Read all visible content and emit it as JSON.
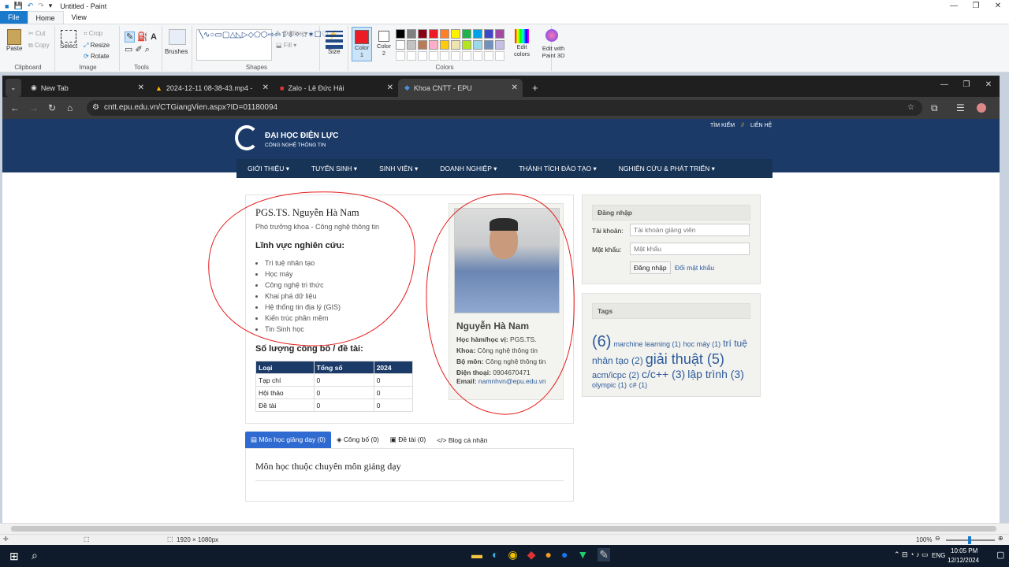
{
  "paint": {
    "title": "Untitled - Paint",
    "tabs": [
      "File",
      "Home",
      "View"
    ],
    "clipboard": {
      "paste": "Paste",
      "cut": "Cut",
      "copy": "Copy",
      "label": "Clipboard"
    },
    "image": {
      "select": "Select",
      "crop": "Crop",
      "resize": "Resize",
      "rotate": "Rotate",
      "label": "Image"
    },
    "tools": {
      "label": "Tools"
    },
    "brushes": {
      "label": "Brushes"
    },
    "shapes": {
      "outline": "Outline",
      "fill": "Fill",
      "label": "Shapes"
    },
    "size": {
      "label": "Size"
    },
    "colors": {
      "color1": "Color 1",
      "color2": "Color 2",
      "edit": "Edit colors",
      "paint3d": "Edit with Paint 3D",
      "label": "Colors",
      "palette": [
        "#000000",
        "#7f7f7f",
        "#880015",
        "#ed1c24",
        "#ff7f27",
        "#fff200",
        "#22b14c",
        "#00a2e8",
        "#3f48cc",
        "#a349a4",
        "#ffffff",
        "#c3c3c3",
        "#b97a57",
        "#ffaec9",
        "#ffc90e",
        "#efe4b0",
        "#b5e61d",
        "#99d9ea",
        "#7092be",
        "#c8bfe7"
      ]
    },
    "status": {
      "size": "1920 × 1080px",
      "zoom": "100%"
    }
  },
  "browser": {
    "tabs": [
      {
        "label": "New Tab"
      },
      {
        "label": "2024-12-11 08-38-43.mp4 - Go"
      },
      {
        "label": "Zalo - Lê Đức Hải"
      },
      {
        "label": "Khoa CNTT - EPU"
      }
    ],
    "url": "cntt.epu.edu.vn/CTGiangVien.aspx?ID=01180094"
  },
  "site": {
    "logo_line1": "ĐẠI HỌC ĐIỆN LỰC",
    "logo_line2": "CÔNG NGHỆ THÔNG TIN",
    "top_links": [
      "TÌM KIẾM",
      "//",
      "LIÊN HỆ"
    ],
    "nav": [
      "GIỚI THIỆU ▾",
      "TUYỂN SINH ▾",
      "SINH VIÊN ▾",
      "DOANH NGHIỆP ▾",
      "THÀNH TÍCH ĐÀO TẠO ▾",
      "NGHIÊN CỨU & PHÁT TRIỂN ▾"
    ]
  },
  "profile": {
    "name_title": "PGS.TS. Nguyễn Hà Nam",
    "position": "Phó trưởng khoa - Công nghệ thông tin",
    "research_heading": "Lĩnh vực nghiên cứu:",
    "research": [
      "Trí tuệ nhân tạo",
      "Học máy",
      "Công nghệ tri thức",
      "Khai phá dữ liệu",
      "Hệ thống tin địa lý (GIS)",
      "Kiến trúc phần mềm",
      "Tin Sinh học"
    ],
    "pub_heading": "Số lượng công bố / đề tài:",
    "table_headers": [
      "Loại",
      "Tổng số",
      "2024"
    ],
    "table_rows": [
      [
        "Tạp chí",
        "0",
        "0"
      ],
      [
        "Hội thảo",
        "0",
        "0"
      ],
      [
        "Đề tài",
        "0",
        "0"
      ]
    ],
    "card": {
      "name": "Nguyễn Hà Nam",
      "rows": [
        {
          "k": "Học hàm/học vị:",
          "v": "PGS.TS."
        },
        {
          "k": "Khoa:",
          "v": "Công nghệ thông tin"
        },
        {
          "k": "Bộ môn:",
          "v": "Công nghệ thông tin"
        },
        {
          "k": "Điện thoại:",
          "v": "0904670471"
        }
      ],
      "email_label": "Email:",
      "email": "namnhvn@epu.edu.vn"
    },
    "tabs": [
      "Môn học giảng dạy (0)",
      "Công bố (0)",
      "Đề tài (0)",
      "Blog cá nhân"
    ],
    "tab_content_title": "Môn học thuộc chuyên môn giảng dạy"
  },
  "login": {
    "heading": "Đăng nhập",
    "user_label": "Tài khoản:",
    "user_placeholder": "Tài khoản giảng viên",
    "pass_label": "Mật khẩu:",
    "pass_placeholder": "Mật khẩu",
    "submit": "Đăng nhập",
    "change": "Đổi mật khẩu"
  },
  "tags": {
    "heading": "Tags",
    "items": [
      {
        "t": "(6)",
        "s": 20
      },
      {
        "t": "marchine learning (1)",
        "s": 9
      },
      {
        "t": "học máy (1)",
        "s": 9
      },
      {
        "t": "trí tuệ nhân tạo (2)",
        "s": 12
      },
      {
        "t": "giải thuật (5)",
        "s": 18
      },
      {
        "t": "acm/icpc (2)",
        "s": 11
      },
      {
        "t": "c/c++ (3)",
        "s": 14
      },
      {
        "t": "lập trình (3)",
        "s": 14
      },
      {
        "t": "olympic (1)",
        "s": 9
      },
      {
        "t": "c# (1)",
        "s": 9
      }
    ]
  },
  "taskbar": {
    "lang": "ENG",
    "time": "10:05 PM",
    "date": "12/12/2024"
  }
}
